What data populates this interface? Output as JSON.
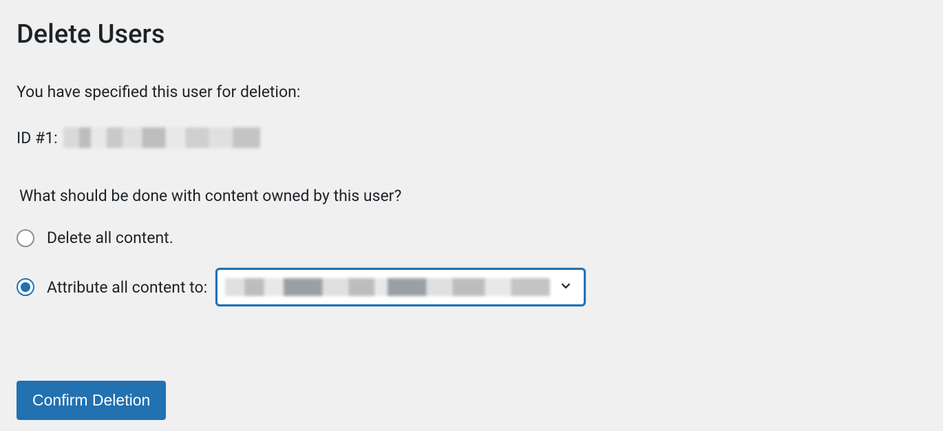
{
  "page": {
    "title": "Delete Users",
    "intro": "You have specified this user for deletion:",
    "user_id_prefix": "ID #1:",
    "user_name_redacted": "████████████",
    "content_question": "What should be done with content owned by this user?",
    "options": {
      "delete_all": "Delete all content.",
      "attribute_to": "Attribute all content to:"
    },
    "reassign_select": {
      "selected_label": "████████ ████████ ██████████"
    },
    "submit_label": "Confirm Deletion"
  }
}
